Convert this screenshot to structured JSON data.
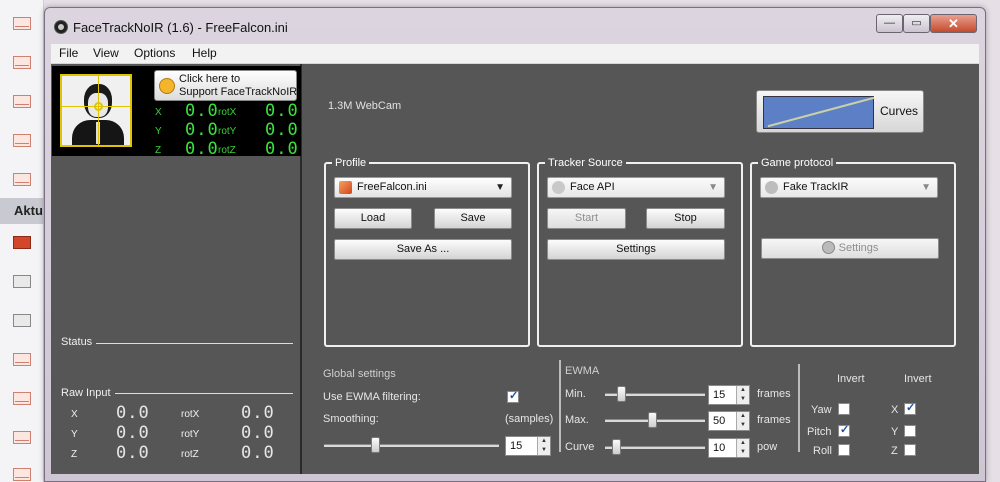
{
  "window": {
    "title": "FaceTrackNoIR (1.6) - FreeFalcon.ini",
    "minimize": "—",
    "maximize": "▭",
    "close": "✕"
  },
  "background": {
    "side_label": "Aktu"
  },
  "menu": [
    "File",
    "View",
    "Options",
    "Help"
  ],
  "support": {
    "line1": "Click here to",
    "line2": "Support FaceTrackNoIR!"
  },
  "pose": {
    "labels": {
      "x": "X",
      "y": "Y",
      "z": "Z",
      "rotx": "rotX",
      "roty": "rotY",
      "rotz": "rotZ"
    },
    "values": {
      "x": "0.0",
      "y": "0.0",
      "z": "0.0",
      "rotx": "0.0",
      "roty": "0.0",
      "rotz": "0.0"
    }
  },
  "status": {
    "heading": "Status"
  },
  "raw_input": {
    "heading": "Raw Input",
    "labels": {
      "x": "X",
      "y": "Y",
      "z": "Z",
      "rotx": "rotX",
      "roty": "rotY",
      "rotz": "rotZ"
    },
    "values": {
      "x": "0.0",
      "y": "0.0",
      "z": "0.0",
      "rotx": "0.0",
      "roty": "0.0",
      "rotz": "0.0"
    }
  },
  "camera": {
    "name": "1.3M WebCam"
  },
  "curves": {
    "label": "Curves"
  },
  "profile": {
    "title": "Profile",
    "selected": "FreeFalcon.ini",
    "load": "Load",
    "save": "Save",
    "save_as": "Save As ..."
  },
  "tracker": {
    "title": "Tracker Source",
    "selected": "Face API",
    "start": "Start",
    "stop": "Stop",
    "settings": "Settings"
  },
  "game": {
    "title": "Game protocol",
    "selected": "Fake TrackIR",
    "settings": "Settings"
  },
  "global": {
    "heading": "Global settings",
    "use_ewma_label": "Use EWMA filtering:",
    "use_ewma_checked": true,
    "smoothing_label": "Smoothing:",
    "smoothing_unit": "(samples)",
    "smoothing_value": "15",
    "smoothing_slider_fraction": 0.29
  },
  "ewma": {
    "heading": "EWMA",
    "min_label": "Min.",
    "min_value": "15",
    "min_unit": "frames",
    "max_label": "Max.",
    "max_value": "50",
    "max_unit": "frames",
    "curve_label": "Curve",
    "curve_value": "10",
    "curve_unit": "pow"
  },
  "invert": {
    "heading_left": "Invert",
    "heading_right": "Invert",
    "yaw": "Yaw",
    "pitch": "Pitch",
    "roll": "Roll",
    "x": "X",
    "y": "Y",
    "z": "Z",
    "yaw_checked": false,
    "pitch_checked": true,
    "roll_checked": false,
    "x_checked": true,
    "y_checked": false,
    "z_checked": false
  },
  "colors": {
    "client_bg": "#565656",
    "digit_green": "#3ae23a",
    "frame_yellow": "#e0c400"
  }
}
